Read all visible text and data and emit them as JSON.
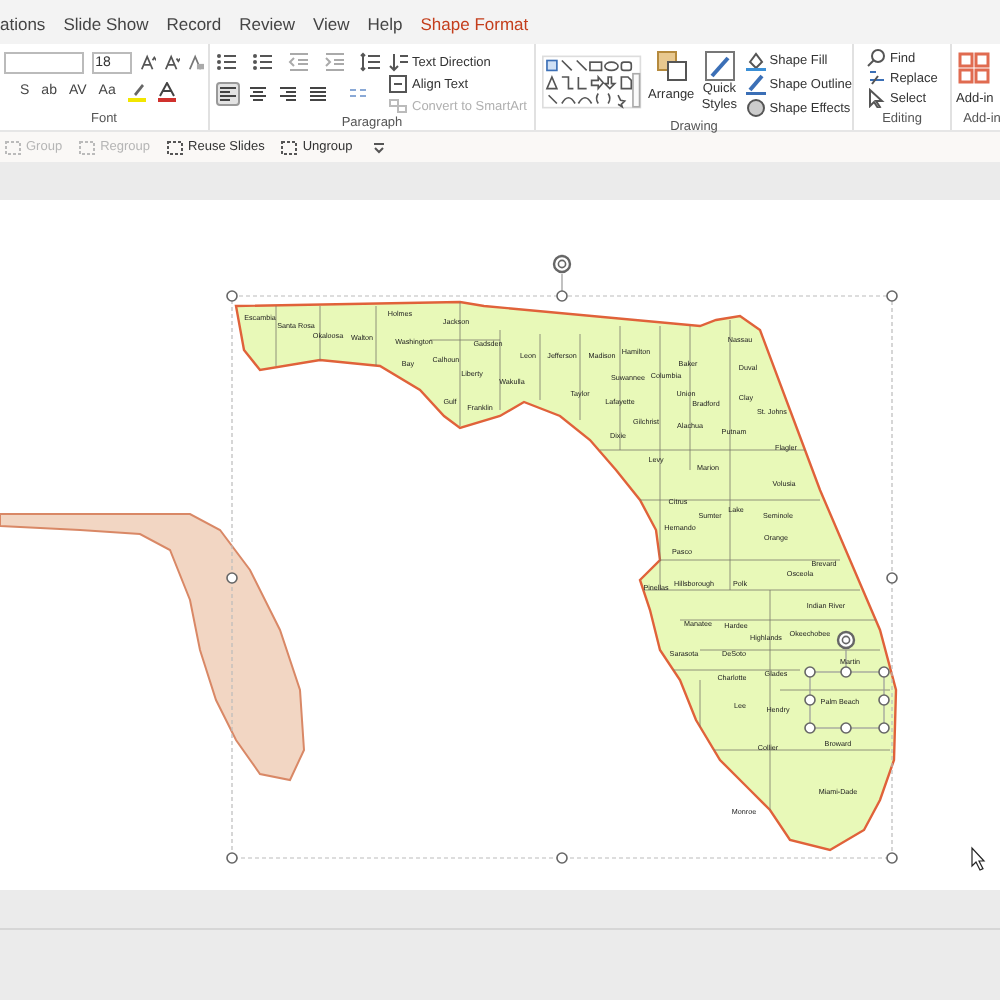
{
  "tabs": [
    {
      "label": "ations",
      "selected": false
    },
    {
      "label": "Slide Show",
      "selected": false
    },
    {
      "label": "Record",
      "selected": false
    },
    {
      "label": "Review",
      "selected": false
    },
    {
      "label": "View",
      "selected": false
    },
    {
      "label": "Help",
      "selected": false
    },
    {
      "label": "Shape Format",
      "selected": true
    }
  ],
  "ribbon": {
    "font": {
      "label": "Font",
      "size": "18",
      "format_buttons": [
        "S",
        "ab",
        "AV",
        "Aa"
      ]
    },
    "paragraph": {
      "label": "Paragraph",
      "alignment": [
        {
          "selected": true
        },
        {
          "selected": false
        },
        {
          "selected": false
        },
        {
          "selected": false
        }
      ],
      "text_commands": [
        {
          "label": "Text Direction",
          "disabled": false
        },
        {
          "label": "Align Text",
          "disabled": false
        },
        {
          "label": "Convert to SmartArt",
          "disabled": true
        }
      ]
    },
    "drawing": {
      "label": "Drawing",
      "arrange": "Arrange",
      "quick_styles": [
        "Quick",
        "Styles"
      ],
      "commands": [
        "Shape Fill",
        "Shape Outline",
        "Shape Effects"
      ]
    },
    "editing": {
      "label": "Editing",
      "commands": [
        "Find",
        "Replace",
        "Select"
      ]
    },
    "addins": {
      "label": "Add-in",
      "button": "Add-in"
    }
  },
  "quick_toolbar": [
    {
      "label": "Group",
      "disabled": true
    },
    {
      "label": "Regroup",
      "disabled": true
    },
    {
      "label": "Reuse Slides",
      "disabled": false
    },
    {
      "label": "Ungroup",
      "disabled": false
    }
  ],
  "slide": {
    "county_labels": [
      "Escambia",
      "Santa Rosa",
      "Okaloosa",
      "Walton",
      "Holmes",
      "Washington",
      "Jackson",
      "Bay",
      "Calhoun",
      "Gadsden",
      "Leon",
      "Jefferson",
      "Madison",
      "Liberty",
      "Wakulla",
      "Gulf",
      "Franklin",
      "Taylor",
      "Hamilton",
      "Suwannee",
      "Columbia",
      "Baker",
      "Nassau",
      "Duval",
      "Lafayette",
      "Union",
      "Bradford",
      "Clay",
      "St. Johns",
      "Gilchrist",
      "Dixie",
      "Alachua",
      "Putnam",
      "Flagler",
      "Levy",
      "Marion",
      "Volusia",
      "Citrus",
      "Sumter",
      "Lake",
      "Seminole",
      "Hernando",
      "Orange",
      "Pasco",
      "Brevard",
      "Pinellas",
      "Hillsborough",
      "Polk",
      "Osceola",
      "Indian River",
      "Manatee",
      "Hardee",
      "Highlands",
      "Okeechobee",
      "Martin",
      "Sarasota",
      "DeSoto",
      "Charlotte",
      "Glades",
      "Palm Beach",
      "Lee",
      "Hendry",
      "Broward",
      "Collier",
      "Monroe",
      "Miami-Dade"
    ]
  }
}
